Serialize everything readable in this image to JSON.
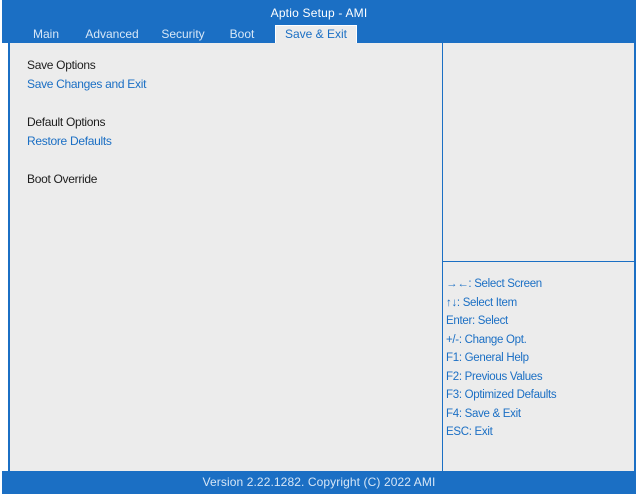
{
  "header": {
    "title": "Aptio Setup -  AMI",
    "tabs": [
      {
        "label": "Main"
      },
      {
        "label": "Advanced"
      },
      {
        "label": "Security"
      },
      {
        "label": "Boot"
      },
      {
        "label": "Save & Exit",
        "active": true
      }
    ]
  },
  "menu": {
    "save_options_heading": "Save Options",
    "save_changes_and_exit": "Save Changes and Exit",
    "default_options_heading": "Default Options",
    "restore_defaults": "Restore Defaults",
    "boot_override_heading": "Boot Override"
  },
  "help": {
    "keys": [
      "→←: Select Screen",
      "↑↓: Select Item",
      "Enter: Select",
      "+/-: Change Opt.",
      "F1: General Help",
      "F2: Previous Values",
      "F3: Optimized Defaults",
      "F4: Save & Exit",
      "ESC: Exit"
    ]
  },
  "footer": {
    "version": "Version 2.22.1282. Copyright  (C)  2022 AMI"
  },
  "colors": {
    "accent": "#1b6fc4",
    "panel_bg": "#ececec",
    "text": "#1d1d1d"
  }
}
